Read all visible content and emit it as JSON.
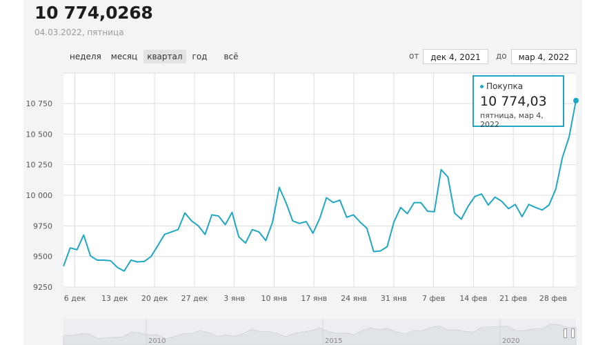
{
  "header": {
    "price": "10 774,0268",
    "date": "04.03.2022, пятница"
  },
  "periods": [
    {
      "label": "неделя",
      "active": false
    },
    {
      "label": "месяц",
      "active": false
    },
    {
      "label": "квартал",
      "active": true
    },
    {
      "label": "год",
      "active": false
    },
    {
      "label": "всё",
      "active": false
    }
  ],
  "range": {
    "from_label": "от",
    "from_value": "дек 4, 2021",
    "to_label": "до",
    "to_value": "мар 4, 2022"
  },
  "tooltip": {
    "series": "Покупка",
    "value": "10 774,03",
    "date": "пятница, мар 4, 2022"
  },
  "colors": {
    "line": "#1ea6c6",
    "grid": "#dcdde0",
    "panel": "#f3f4f6"
  },
  "navigator": {
    "labels": [
      "2010",
      "2015",
      "2020"
    ]
  },
  "chart_data": {
    "type": "line",
    "series_name": "Покупка",
    "ylim": [
      9250,
      10850
    ],
    "y_ticks": [
      9250,
      9500,
      9750,
      10000,
      10250,
      10500,
      10750
    ],
    "y_tick_labels": [
      "9250",
      "9500",
      "9750",
      "10 000",
      "10 250",
      "10 500",
      "10 750"
    ],
    "x_tick_labels": [
      "6 дек",
      "13 дек",
      "20 дек",
      "27 дек",
      "3 янв",
      "10 янв",
      "17 янв",
      "24 янв",
      "31 янв",
      "7 фев",
      "14 фев",
      "21 фев",
      "28 фев"
    ],
    "x_tick_days": [
      2,
      9,
      16,
      23,
      30,
      37,
      44,
      51,
      58,
      65,
      72,
      79,
      86
    ],
    "x_range": [
      0,
      90
    ],
    "x": [
      0,
      1,
      2,
      3,
      4,
      5,
      6,
      7,
      8,
      9,
      10,
      11,
      12,
      13,
      14,
      15,
      16,
      17,
      18,
      19,
      20,
      21,
      22,
      23,
      24,
      25,
      26,
      27,
      28,
      29,
      30,
      31,
      32,
      33,
      34,
      35,
      36,
      37,
      38,
      39,
      40,
      41,
      42,
      43,
      44,
      45,
      46,
      47,
      48,
      49,
      50,
      51,
      52,
      53,
      54,
      55,
      56,
      57,
      58,
      59,
      60,
      61,
      62,
      63,
      64,
      65,
      66,
      67,
      68,
      69,
      70,
      71,
      72,
      73,
      74,
      75,
      76,
      77,
      78,
      79,
      80,
      81,
      82,
      83,
      84,
      85,
      86,
      87,
      88,
      89,
      90
    ],
    "values": [
      9420,
      9570,
      9555,
      9675,
      9505,
      9470,
      9470,
      9465,
      9410,
      9380,
      9470,
      9455,
      9460,
      9500,
      9590,
      9680,
      9700,
      9720,
      9855,
      9790,
      9750,
      9680,
      9840,
      9830,
      9760,
      9860,
      9660,
      9610,
      9720,
      9700,
      9630,
      9780,
      10065,
      9940,
      9790,
      9770,
      9785,
      9690,
      9810,
      9980,
      9940,
      9960,
      9820,
      9840,
      9780,
      9730,
      9540,
      9545,
      9580,
      9780,
      9900,
      9850,
      9940,
      9940,
      9870,
      9865,
      10210,
      10150,
      9855,
      9805,
      9910,
      9990,
      10010,
      9920,
      9985,
      9950,
      9890,
      9925,
      9825,
      9925,
      9900,
      9880,
      9920,
      10050,
      10310,
      10480,
      10774
    ]
  }
}
